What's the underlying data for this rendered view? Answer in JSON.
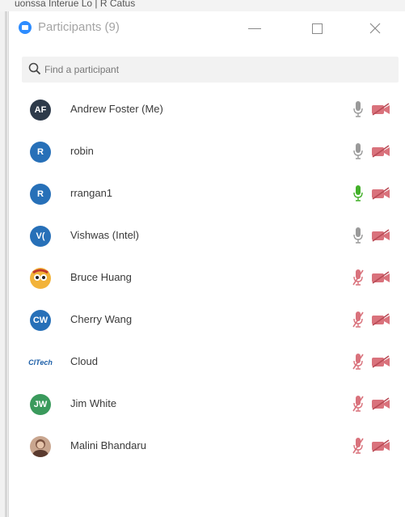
{
  "background_window": {
    "text": "uonssa     Interue Lo     |  R  Catus"
  },
  "window": {
    "title": "Participants (9)",
    "controls": [
      "minimize",
      "maximize",
      "close"
    ]
  },
  "search": {
    "placeholder": "Find a participant"
  },
  "colors": {
    "accent": "#2d8cff",
    "mic_active": "#43b02a",
    "mic_idle": "#9a9a9a",
    "muted": "#d9727c",
    "avatar_blue": "#2770b8",
    "avatar_dark": "#2d3a4a",
    "avatar_green": "#3a9a5c"
  },
  "participants": [
    {
      "name": "Andrew Foster (Me)",
      "initials": "AF",
      "avatar": "dark",
      "mic": "idle",
      "video": "off"
    },
    {
      "name": "robin",
      "initials": "R",
      "avatar": "blue",
      "mic": "idle",
      "video": "off"
    },
    {
      "name": "rrangan1",
      "initials": "R",
      "avatar": "blue",
      "mic": "active",
      "video": "off"
    },
    {
      "name": "Vishwas (Intel)",
      "initials": "V(",
      "avatar": "blue",
      "mic": "idle",
      "video": "off"
    },
    {
      "name": "Bruce Huang",
      "initials": "",
      "avatar": "emoji",
      "mic": "muted",
      "video": "off"
    },
    {
      "name": "Cherry Wang",
      "initials": "CW",
      "avatar": "blue",
      "mic": "muted",
      "video": "off"
    },
    {
      "name": "Cloud",
      "initials": "ClTech",
      "avatar": "logo",
      "mic": "muted",
      "video": "off"
    },
    {
      "name": "Jim White",
      "initials": "JW",
      "avatar": "green",
      "mic": "muted",
      "video": "off"
    },
    {
      "name": "Malini Bhandaru",
      "initials": "",
      "avatar": "photo",
      "mic": "muted",
      "video": "off"
    }
  ]
}
